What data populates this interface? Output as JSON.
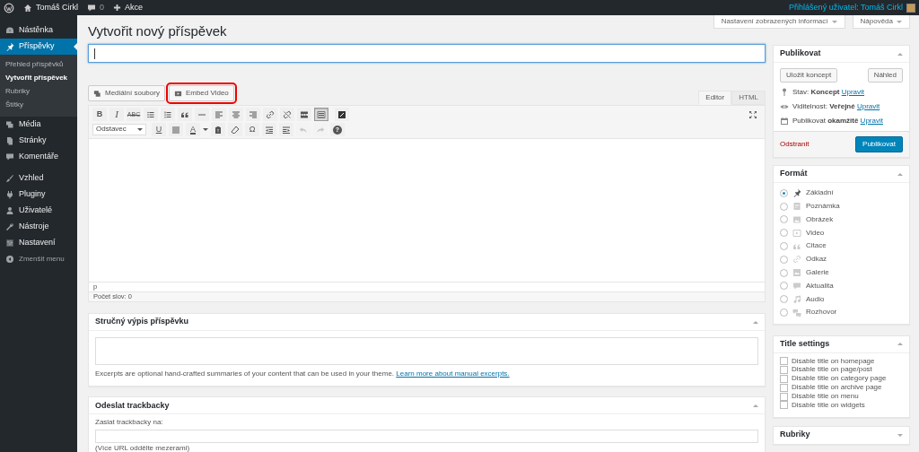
{
  "admin_bar": {
    "site": "Tomáš Cirkl",
    "comments": "0",
    "new": "Akce",
    "account": "Přihlášený uživatel: Tomáš Cirkl"
  },
  "screen_buttons": [
    "Nastavení zobrazených informací",
    "Nápověda"
  ],
  "sidebar": {
    "groups": [
      [
        {
          "kind": "dashboard",
          "label": "Nástěnka",
          "selected": false
        },
        {
          "kind": "pin",
          "label": "Příspěvky",
          "selected": true,
          "children": [
            {
              "label": "Přehled příspěvků",
              "selected": false
            },
            {
              "label": "Vytvořit příspěvek",
              "selected": true
            },
            {
              "label": "Rubriky",
              "selected": false
            },
            {
              "label": "Štítky",
              "selected": false
            }
          ]
        },
        {
          "kind": "media",
          "label": "Média",
          "selected": false
        },
        {
          "kind": "pages",
          "label": "Stránky",
          "selected": false
        },
        {
          "kind": "comments",
          "label": "Komentáře",
          "selected": false
        }
      ],
      [
        {
          "kind": "appearance",
          "label": "Vzhled",
          "selected": false
        },
        {
          "kind": "plugins",
          "label": "Pluginy",
          "selected": false
        },
        {
          "kind": "users",
          "label": "Uživatelé",
          "selected": false
        },
        {
          "kind": "tools",
          "label": "Nástroje",
          "selected": false
        },
        {
          "kind": "settings",
          "label": "Nastavení",
          "selected": false
        }
      ]
    ],
    "collapse": "Zmenšit menu"
  },
  "page_title": "Vytvořit nový příspěvek",
  "post_title": {
    "focused": true
  },
  "media_buttons": [
    {
      "kind": "media",
      "label": "Mediální soubory",
      "highlighted": false
    },
    {
      "kind": "video",
      "label": "Embed Video",
      "highlighted": true
    }
  ],
  "editor_tabs": [
    {
      "label": "Editor",
      "selected": true
    },
    {
      "label": "HTML",
      "selected": false
    }
  ],
  "toolbar": {
    "row1": [
      {
        "kind": "bold",
        "glyph": "B",
        "pressed": false
      },
      {
        "kind": "italic",
        "glyph": "I",
        "pressed": false
      },
      {
        "kind": "strike",
        "glyph": "ABC",
        "pressed": false
      },
      {
        "kind": "bullets",
        "pressed": false
      },
      {
        "kind": "numbers",
        "pressed": false
      },
      {
        "kind": "quote",
        "pressed": false
      },
      {
        "kind": "hr",
        "pressed": false
      },
      {
        "kind": "align-left",
        "pressed": false
      },
      {
        "kind": "align-center",
        "pressed": false
      },
      {
        "kind": "align-right",
        "pressed": false
      },
      {
        "kind": "link",
        "pressed": false
      },
      {
        "kind": "unlink",
        "pressed": false
      },
      {
        "kind": "more",
        "pressed": false
      },
      {
        "kind": "toggle",
        "pressed": true
      },
      {
        "kind": "dfw",
        "pressed": false
      }
    ],
    "format_select": "Odstavec",
    "row2": [
      {
        "kind": "underline",
        "glyph": "U",
        "disabled": false
      },
      {
        "kind": "justify",
        "disabled": false
      },
      {
        "kind": "color",
        "glyph": "A",
        "disabled": false
      },
      {
        "kind": "paste",
        "disabled": false
      },
      {
        "kind": "clear",
        "disabled": false
      },
      {
        "kind": "omega",
        "glyph": "Ω",
        "disabled": false
      },
      {
        "kind": "outdent",
        "disabled": false
      },
      {
        "kind": "indent",
        "disabled": false
      },
      {
        "kind": "undo",
        "disabled": true
      },
      {
        "kind": "redo",
        "disabled": true
      },
      {
        "kind": "help",
        "glyph": "?",
        "disabled": false
      }
    ]
  },
  "editor": {
    "path": "p",
    "word_count": "Počet slov: 0"
  },
  "excerpt": {
    "title": "Stručný výpis příspěvku",
    "expanded": true,
    "help": "Excerpts are optional hand-crafted summaries of your content that can be used in your theme.",
    "link": "Learn more about manual excerpts."
  },
  "trackbacks": {
    "title": "Odeslat trackbacky",
    "expanded": true,
    "label": "Zaslat trackbacky na:",
    "hint": "(Více URL oddělte mezerami)"
  },
  "publish": {
    "title": "Publikovat",
    "expanded": true,
    "save_draft": "Uložit koncept",
    "preview": "Náhled",
    "rows": [
      {
        "kind": "status",
        "text": "Stav: **Koncept**",
        "link": "Upravit"
      },
      {
        "kind": "visibility",
        "text": "Viditelnost: **Veřejné**",
        "link": "Upravit"
      },
      {
        "kind": "schedule",
        "text": "Publikovat **okamžitě**",
        "link": "Upravit"
      }
    ],
    "trash": "Odstranit",
    "publish": "Publikovat"
  },
  "format": {
    "title": "Formát",
    "expanded": true,
    "options": [
      {
        "kind": "standard",
        "label": "Základní",
        "selected": true
      },
      {
        "kind": "aside",
        "label": "Poznámka",
        "selected": false
      },
      {
        "kind": "image",
        "label": "Obrázek",
        "selected": false
      },
      {
        "kind": "video",
        "label": "Video",
        "selected": false
      },
      {
        "kind": "quote",
        "label": "Citace",
        "selected": false
      },
      {
        "kind": "link",
        "label": "Odkaz",
        "selected": false
      },
      {
        "kind": "gallery",
        "label": "Galerie",
        "selected": false
      },
      {
        "kind": "status",
        "label": "Aktualita",
        "selected": false
      },
      {
        "kind": "audio",
        "label": "Audio",
        "selected": false
      },
      {
        "kind": "chat",
        "label": "Rozhovor",
        "selected": false
      }
    ]
  },
  "title_settings": {
    "title": "Title settings",
    "expanded": true,
    "options": [
      {
        "label": "Disable title on homepage",
        "checked": false
      },
      {
        "label": "Disable title on page/post",
        "checked": false
      },
      {
        "label": "Disable title on category page",
        "checked": false
      },
      {
        "label": "Disable title on archive page",
        "checked": false
      },
      {
        "label": "Disable title on menu",
        "checked": false
      },
      {
        "label": "Disable title on widgets",
        "checked": false
      }
    ]
  },
  "categories": {
    "title": "Rubriky",
    "expanded": false
  }
}
